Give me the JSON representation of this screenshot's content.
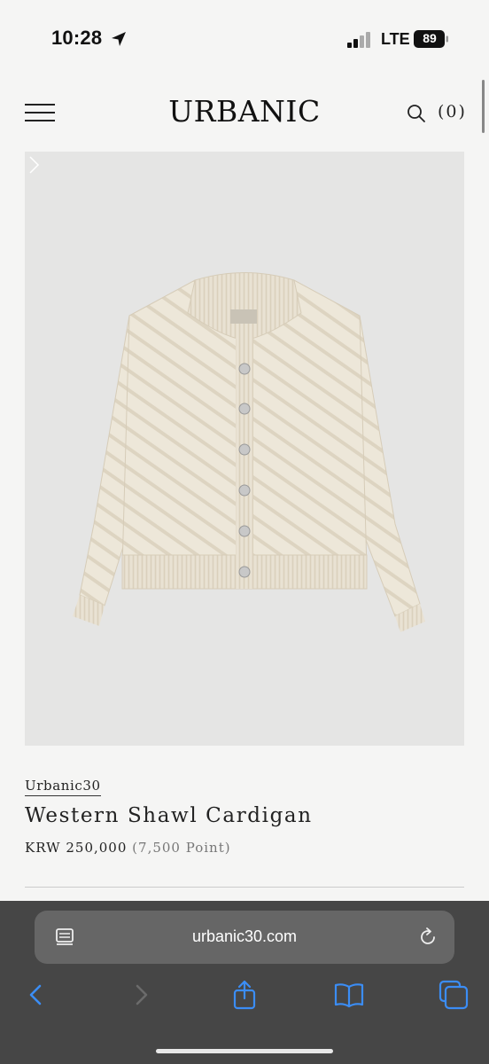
{
  "status_bar": {
    "time": "10:28",
    "network": "LTE",
    "battery": "89"
  },
  "header": {
    "logo": "URBANIC",
    "cart_count": "(0)",
    "icons": [
      "hamburger-menu-icon",
      "search-icon"
    ]
  },
  "product": {
    "brand": "Urbanic30",
    "name": "Western Shawl Cardigan",
    "price": "KRW 250,000",
    "points": "(7,500 Point)",
    "image_icon": "cardigan-image"
  },
  "browser": {
    "url": "urbanic30.com",
    "toolbar": [
      "back-icon",
      "forward-icon",
      "share-icon",
      "bookmarks-icon",
      "tabs-icon"
    ]
  },
  "colors": {
    "page_bg": "#f5f5f4",
    "image_bg": "#e5e5e4",
    "safari_bar": "#464646",
    "safari_accent": "#3b8df5"
  }
}
